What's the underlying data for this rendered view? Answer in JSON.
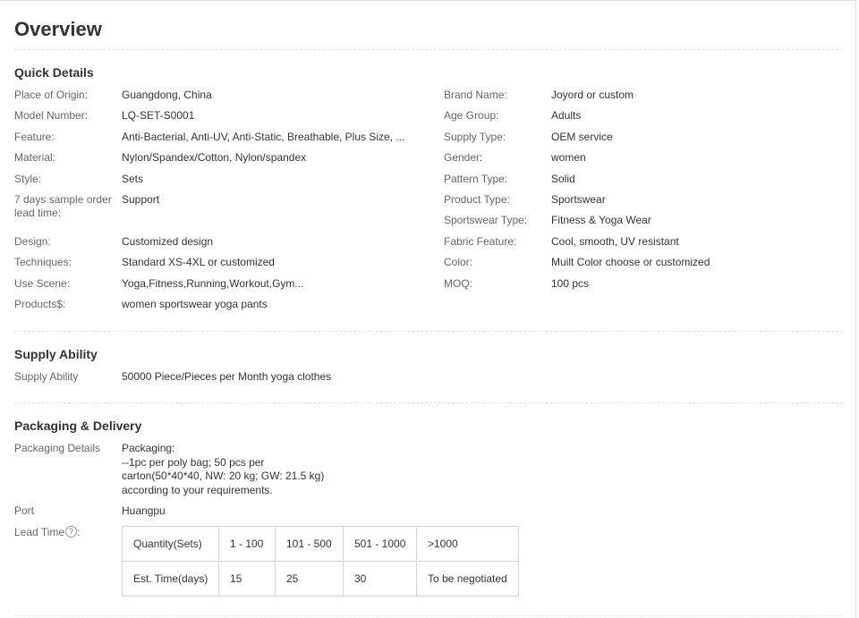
{
  "title": "Overview",
  "quick_details": {
    "heading": "Quick Details",
    "left": [
      {
        "label": "Place of Origin:",
        "value": "Guangdong, China"
      },
      {
        "label": "Model Number:",
        "value": "LQ-SET-S0001"
      },
      {
        "label": "Feature:",
        "value": "Anti-Bacterial, Anti-UV, Anti-Static, Breathable, Plus Size, ..."
      },
      {
        "label": "Material:",
        "value": "Nylon/Spandex/Cotton, Nylon/spandex"
      },
      {
        "label": "Style:",
        "value": "Sets"
      },
      {
        "label": "7 days sample order lead time:",
        "value": "Support"
      },
      {
        "label": "Design:",
        "value": "Customized design"
      },
      {
        "label": "Techniques:",
        "value": "Standard XS-4XL or customized"
      },
      {
        "label": "Use Scene:",
        "value": "Yoga,Fitness,Running,Workout,Gym..."
      },
      {
        "label": "Products$:",
        "value": "women sportswear yoga pants"
      }
    ],
    "right": [
      {
        "label": "Brand Name:",
        "value": "Joyord or custom"
      },
      {
        "label": "Age Group:",
        "value": "Adults"
      },
      {
        "label": "Supply Type:",
        "value": "OEM service"
      },
      {
        "label": "Gender:",
        "value": "women"
      },
      {
        "label": "Pattern Type:",
        "value": "Solid"
      },
      {
        "label": "Product Type:",
        "value": "Sportswear"
      },
      {
        "label": "Sportswear Type:",
        "value": "Fitness & Yoga Wear"
      },
      {
        "label": "Fabric Feature:",
        "value": "Cool, smooth, UV resistant"
      },
      {
        "label": "Color:",
        "value": "Muilt Color choose or customized"
      },
      {
        "label": "MOQ:",
        "value": "100 pcs"
      }
    ]
  },
  "supply_ability": {
    "heading": "Supply Ability",
    "label": "Supply Ability",
    "value": "50000 Piece/Pieces per Month yoga clothes"
  },
  "packaging": {
    "heading": "Packaging & Delivery",
    "details_label": "Packaging Details",
    "details_lines": [
      "Packaging:",
      "--1pc per poly bag; 50 pcs per",
      "carton(50*40*40, NW: 20 kg; GW: 21.5 kg)",
      "according to your requirements."
    ],
    "port_label": "Port",
    "port_value": "Huangpu",
    "lead_time_label": "Lead Time",
    "help_icon_glyph": "?",
    "lead_table": {
      "header": [
        "Quantity(Sets)",
        "1 - 100",
        "101 - 500",
        "501 - 1000",
        ">1000"
      ],
      "row": [
        "Est. Time(days)",
        "15",
        "25",
        "30",
        "To be negotiated"
      ]
    }
  }
}
